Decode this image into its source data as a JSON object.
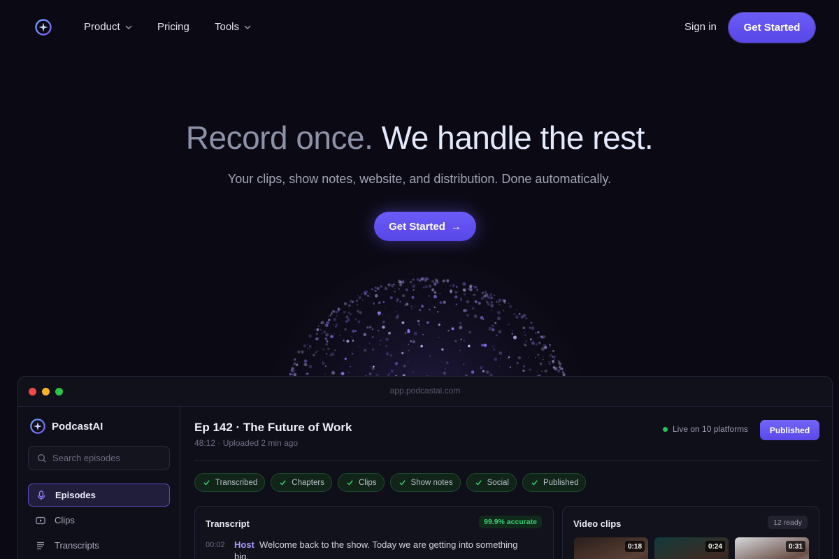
{
  "nav": {
    "items": [
      {
        "label": "Product",
        "dropdown": true
      },
      {
        "label": "Pricing",
        "dropdown": false
      },
      {
        "label": "Tools",
        "dropdown": true
      }
    ],
    "sign_in": "Sign in",
    "cta": "Get Started"
  },
  "hero": {
    "title_dim": "Record once.",
    "title_bright": "We handle the rest.",
    "subtitle": "Your clips, show notes, website, and distribution. Done automatically.",
    "cta": "Get Started",
    "cta_arrow": "→"
  },
  "app": {
    "url": "app.podcastai.com",
    "brand": "PodcastAI",
    "search_placeholder": "Search episodes",
    "sidebar": [
      {
        "label": "Episodes",
        "icon": "mic-icon",
        "active": true
      },
      {
        "label": "Clips",
        "icon": "play-icon",
        "active": false
      },
      {
        "label": "Transcripts",
        "icon": "lines-icon",
        "active": false
      }
    ],
    "episode": {
      "title": "Ep 142 · The Future of Work",
      "meta": "48:12 · Uploaded 2 min ago",
      "live": "Live on 10 platforms",
      "status_button": "Published"
    },
    "chips": [
      "Transcribed",
      "Chapters",
      "Clips",
      "Show notes",
      "Social",
      "Published"
    ],
    "transcript": {
      "title": "Transcript",
      "badge": "99.9% accurate",
      "lines": [
        {
          "time": "00:02",
          "speaker": "Host",
          "text": "Welcome back to the show. Today we are getting into something big."
        }
      ]
    },
    "clips": {
      "title": "Video clips",
      "badge": "12 ready",
      "items": [
        {
          "duration": "0:18"
        },
        {
          "duration": "0:24"
        },
        {
          "duration": "0:31"
        }
      ]
    }
  },
  "colors": {
    "accent": "#6b5cf6",
    "background": "#0b0a14",
    "success": "#22c55e"
  }
}
